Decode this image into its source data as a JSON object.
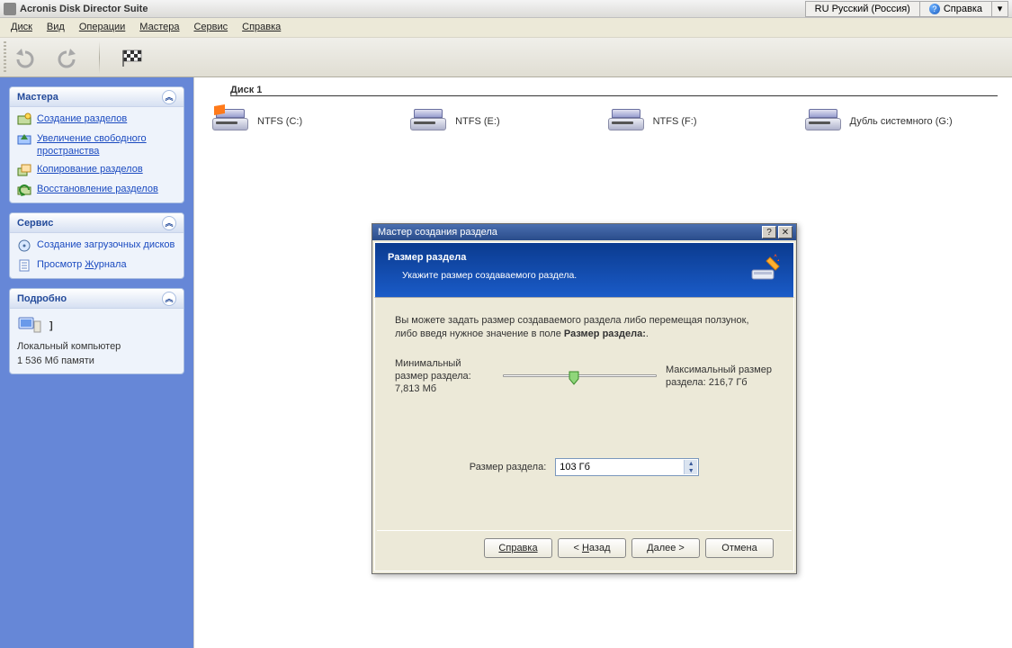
{
  "titlebar": {
    "title": "Acronis Disk Director Suite",
    "lang": "RU Русский (Россия)",
    "help": "Справка"
  },
  "menubar": {
    "items": [
      "Диск",
      "Вид",
      "Операции",
      "Мастера",
      "Сервис",
      "Справка"
    ]
  },
  "sidebar": {
    "panels": [
      {
        "title": "Мастера",
        "items": [
          {
            "label": "Создание разделов",
            "icon": "create-partition-icon"
          },
          {
            "label": "Увеличение свободного пространства",
            "icon": "increase-space-icon"
          },
          {
            "label": "Копирование разделов",
            "icon": "copy-partition-icon"
          },
          {
            "label": "Восстановление разделов",
            "icon": "restore-partition-icon"
          }
        ]
      },
      {
        "title": "Сервис",
        "items": [
          {
            "label": "Создание загрузочных дисков",
            "icon": "boot-disk-icon"
          },
          {
            "label": "Просмотр Журнала",
            "icon": "log-icon"
          }
        ]
      }
    ],
    "info": {
      "title": "Подробно",
      "bracket": "]",
      "computer": "Локальный компьютер",
      "memory": "1 536 Мб памяти"
    }
  },
  "content": {
    "disk_group": "Диск 1",
    "disks": [
      {
        "label": "NTFS (C:)",
        "primary": true
      },
      {
        "label": "NTFS (E:)",
        "primary": false
      },
      {
        "label": "NTFS (F:)",
        "primary": false
      },
      {
        "label": "Дубль системного (G:)",
        "primary": false
      }
    ]
  },
  "dialog": {
    "title": "Мастер создания раздела",
    "banner_heading": "Размер раздела",
    "banner_sub": "Укажите размер создаваемого раздела.",
    "desc_pre": "Вы можете задать размер создаваемого раздела либо перемещая ползунок, либо введя нужное значение в поле ",
    "desc_bold": "Размер раздела:",
    "desc_post": ".",
    "min_label": "Минимальный размер раздела: 7,813 Мб",
    "max_label": "Максимальный размер раздела: 216,7 Гб",
    "size_label": "Размер раздела:",
    "size_value": "103 Гб",
    "buttons": {
      "help": "Справка",
      "back": "< Назад",
      "next": "Далее >",
      "cancel": "Отмена"
    }
  }
}
